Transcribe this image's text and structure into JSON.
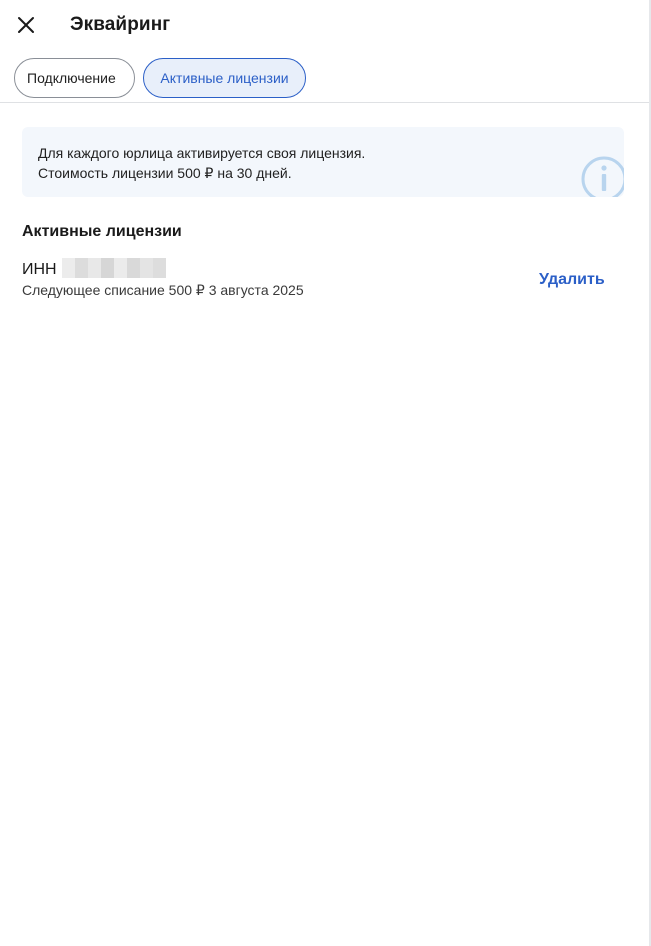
{
  "header": {
    "title": "Эквайринг"
  },
  "tabs": [
    {
      "label": "Подключение",
      "active": false
    },
    {
      "label": "Активные лицензии",
      "active": true
    }
  ],
  "info_card": {
    "line1": "Для каждого юрлица активируется своя лицензия.",
    "line2": "Стоимость лицензии 500 ₽ на 30 дней."
  },
  "section": {
    "title": "Активные лицензии"
  },
  "licenses": [
    {
      "inn_label": "ИНН",
      "next_charge": "Следующее списание 500 ₽ 3 августа 2025",
      "delete_label": "Удалить"
    }
  ],
  "colors": {
    "accent": "#2b5fc7",
    "active_tab_bg": "#e8effa",
    "info_bg": "#f3f7fc",
    "info_icon": "#b8d4ee"
  }
}
